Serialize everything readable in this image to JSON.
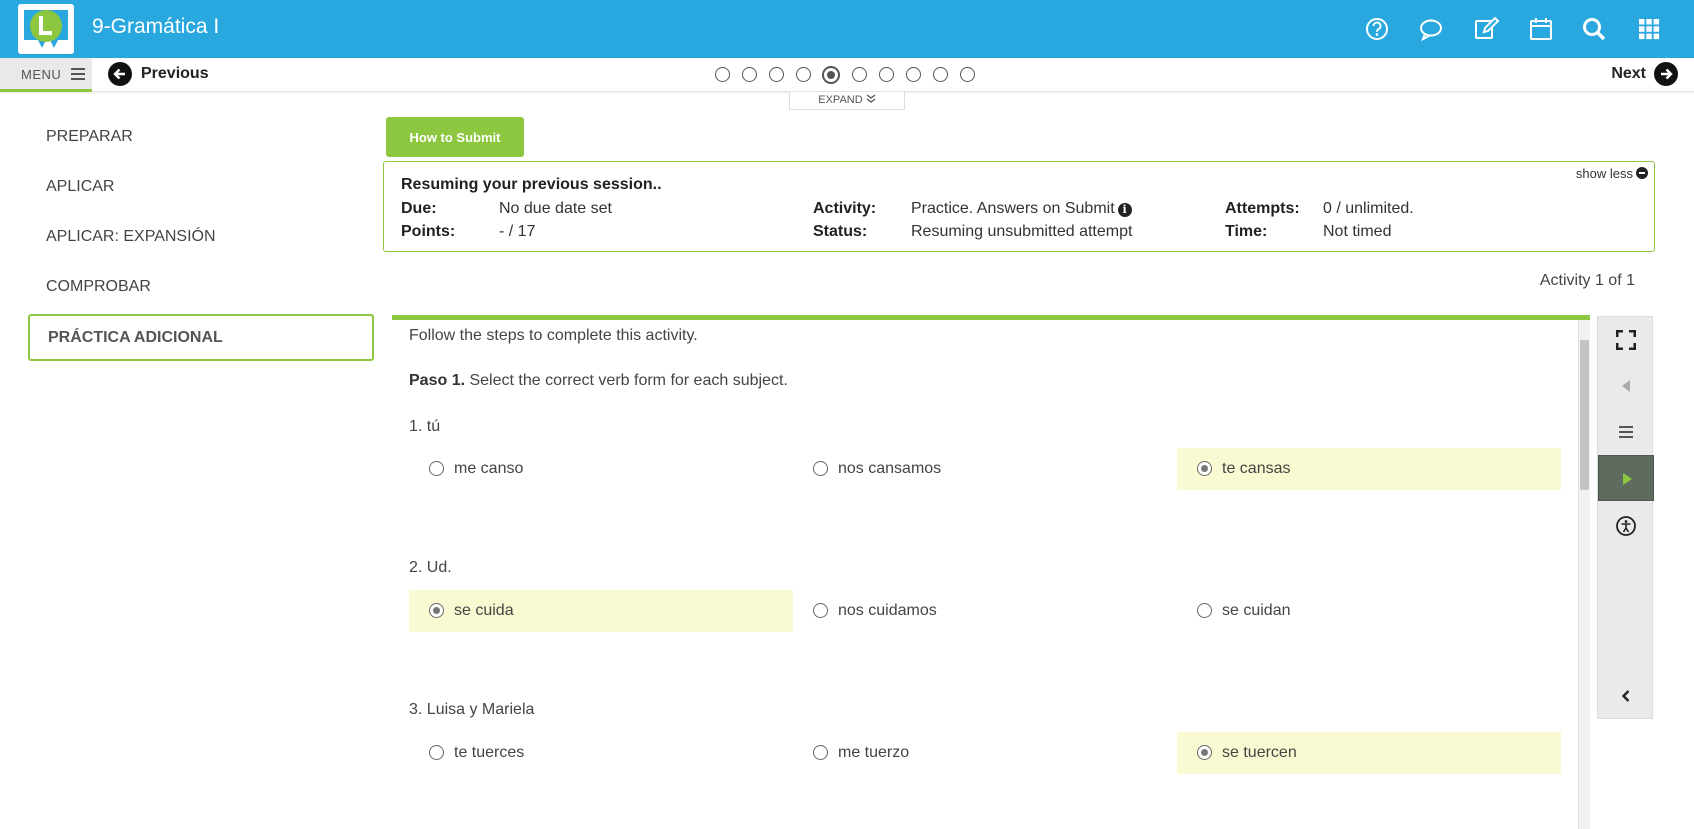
{
  "app": {
    "title": "9-Gramática I",
    "colors": {
      "brand": "#29a8e0",
      "accent": "#8dc63f",
      "selected_bg": "#fafad2"
    }
  },
  "top_icons": [
    "help-icon",
    "chat-icon",
    "edit-icon",
    "calendar-icon",
    "search-icon",
    "apps-grid-icon"
  ],
  "nav": {
    "menu_label": "MENU",
    "previous_label": "Previous",
    "next_label": "Next",
    "page_count": 10,
    "current_page": 5,
    "expand_label": "EXPAND"
  },
  "sidebar": {
    "items": [
      {
        "label": "PREPARAR"
      },
      {
        "label": "APLICAR"
      },
      {
        "label": "APLICAR: EXPANSIÓN"
      },
      {
        "label": "COMPROBAR"
      },
      {
        "label": "PRÁCTICA ADICIONAL",
        "active": true
      }
    ]
  },
  "submit": {
    "how_to_label": "How to Submit"
  },
  "info": {
    "heading": "Resuming your previous session..",
    "show_less_label": "show less",
    "due_label": "Due:",
    "due_value": "No due date set",
    "points_label": "Points:",
    "points_value": "- / 17",
    "activity_label": "Activity:",
    "activity_value": "Practice. Answers on Submit",
    "status_label": "Status:",
    "status_value": "Resuming unsubmitted attempt",
    "attempts_label": "Attempts:",
    "attempts_value": "0 / unlimited.",
    "time_label": "Time:",
    "time_value": "Not timed"
  },
  "activity_counter": "Activity 1 of 1",
  "activity": {
    "intro": "Follow the steps to complete this activity.",
    "step_label": "Paso 1.",
    "step_text": " Select the correct verb form for each subject.",
    "questions": [
      {
        "label": "1. tú",
        "options": [
          "me canso",
          "nos cansamos",
          "te cansas"
        ],
        "selected": 2
      },
      {
        "label": "2. Ud.",
        "options": [
          "se cuida",
          "nos cuidamos",
          "se cuidan"
        ],
        "selected": 0
      },
      {
        "label": "3. Luisa y Mariela",
        "options": [
          "te tuerces",
          "me tuerzo",
          "se tuercen"
        ],
        "selected": 2
      }
    ]
  },
  "toolbar": [
    "fullscreen-icon",
    "back-triangle-icon",
    "list-icon",
    "play-icon",
    "accessibility-icon",
    "collapse-chevron-icon"
  ]
}
